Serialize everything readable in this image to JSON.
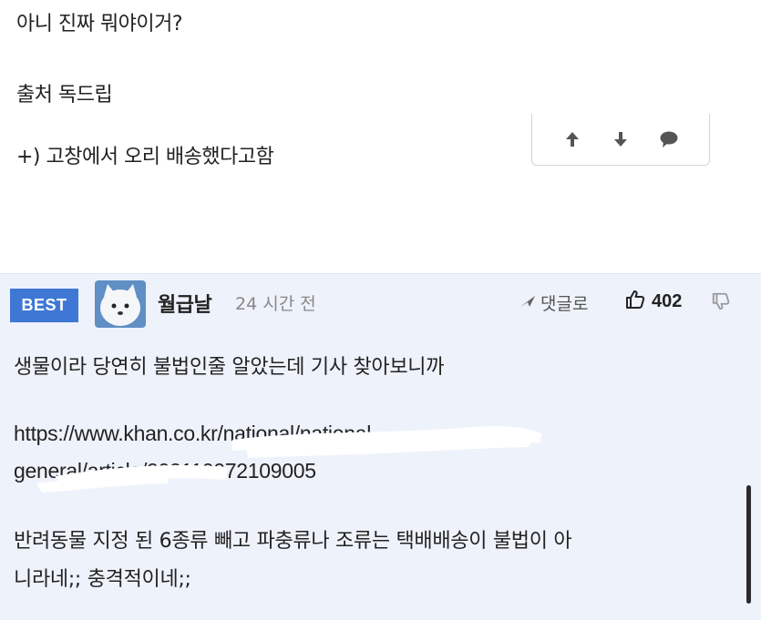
{
  "post": {
    "lines": [
      "아니 진짜 뭐야이거?",
      "출처 독드립",
      "+) 고창에서 오리 배송했다고함"
    ]
  },
  "vote_bar": {
    "icons": [
      "arrow-up-icon",
      "arrow-down-icon",
      "speech-bubble-icon"
    ]
  },
  "comment": {
    "badge": "BEST",
    "nickname": "월급날",
    "time": "24 시간 전",
    "reply_label": "댓글로",
    "like_count": "402",
    "text_lines": [
      "생물이라 당연히 불법인줄 알았는데 기사 찾아보니까",
      "https://www.khan.co.kr/",
      "general/",
      "반려동물 지정 된 6종류 빼고 파충류나 조류는 택배배송이 불법이 아",
      "니라네;; 충격적이네;;"
    ],
    "link_fragments": {
      "line1_tail": "national/national-",
      "line2_tail": "article/202110072109005"
    }
  },
  "colors": {
    "badge_bg": "#3f78d4",
    "comment_bg": "#eef2fb",
    "time_text": "#888888"
  }
}
